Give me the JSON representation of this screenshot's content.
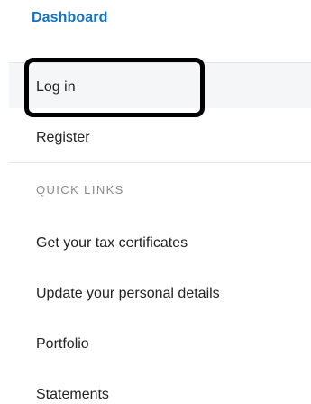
{
  "header": {
    "dashboard_label": "Dashboard"
  },
  "auth": {
    "login_label": "Log in",
    "register_label": "Register"
  },
  "quick_links": {
    "heading": "QUICK LINKS",
    "items": [
      {
        "label": "Get your tax certificates"
      },
      {
        "label": "Update your personal details"
      },
      {
        "label": "Portfolio"
      },
      {
        "label": "Statements"
      }
    ]
  },
  "colors": {
    "link": "#1273c3",
    "text": "#222222",
    "muted": "#8a8a8a",
    "highlight": "#f5f6f7"
  }
}
